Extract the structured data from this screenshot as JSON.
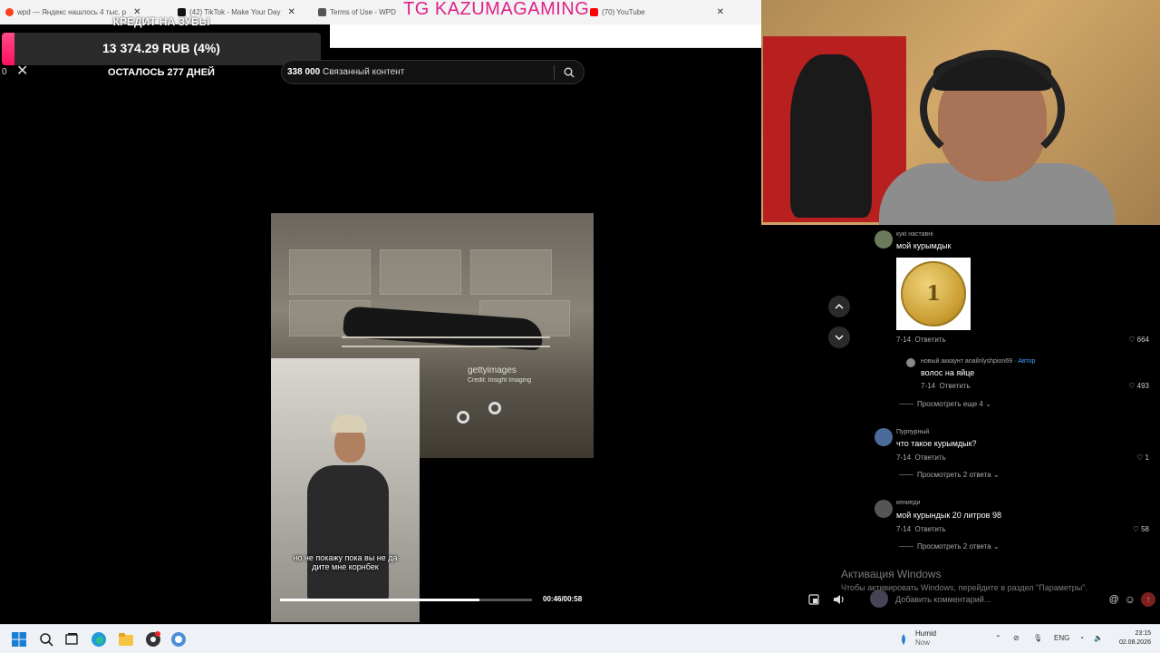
{
  "browser": {
    "tabs": [
      {
        "label": "wpd — Яндекс нашлось 4 тыс. р",
        "color": "#fc3f1d"
      },
      {
        "label": "(42) TikTok - Make Your Day",
        "color": "#111111"
      },
      {
        "label": "Terms of Use - WPD",
        "color": "#555555"
      },
      {
        "label": "(70) YouTube",
        "color": "#ff0000"
      }
    ],
    "overlay_text": "TG KAZUMAGAMING"
  },
  "donation": {
    "title": "КРЕДИТ НА ЗУБЫ",
    "amount": "13 374.29 RUB (4%)",
    "progress_fraction": 0.04,
    "days_left": "ОСТАЛОСЬ 277 ДНЕЙ"
  },
  "left_counter": "0",
  "search": {
    "count": "338 000",
    "text": "Связанный контент"
  },
  "video": {
    "watermark": "gettyimages",
    "credit": "Credit: Insight Imaging",
    "subtitle_line1": "но не покажу пока вы не да",
    "subtitle_line2": "дите мне корнбек",
    "time": "00:46/00:58",
    "progress_fraction": 0.79
  },
  "comments": [
    {
      "user": "кукі наставні",
      "text": "мой курымдык",
      "date": "7-14",
      "reply": "Ответить",
      "likes": "664"
    },
    {
      "user": "новый аккаунт anailnlyshpion69",
      "author_tag": " · Автор",
      "text": "волос на яйце",
      "date": "7-14",
      "reply": "Ответить",
      "likes": "493"
    },
    {
      "more": "Просмотреть еще 4"
    },
    {
      "user": "Пурпурный",
      "text": "что такое курымдык?",
      "date": "7-14",
      "reply": "Ответить",
      "likes": "1"
    },
    {
      "more": "Просмотреть 2 ответа"
    },
    {
      "user": "кениеди",
      "text": "мой курындык 20 литров 98",
      "date": "7-14",
      "reply": "Ответить",
      "likes": "58"
    },
    {
      "more": "Просмотреть 2 ответа"
    }
  ],
  "coin_label": "1",
  "windows": {
    "activate_title": "Активация Windows",
    "activate_sub": "Чтобы активировать Windows, перейдите в раздел \"Параметры\"."
  },
  "comment_input": {
    "placeholder": "Добавить комментарий..."
  },
  "taskbar": {
    "weather_title": "Humid",
    "weather_sub": "Now",
    "lang": "ENG",
    "time": "23:15",
    "date": "02.08.2026"
  }
}
